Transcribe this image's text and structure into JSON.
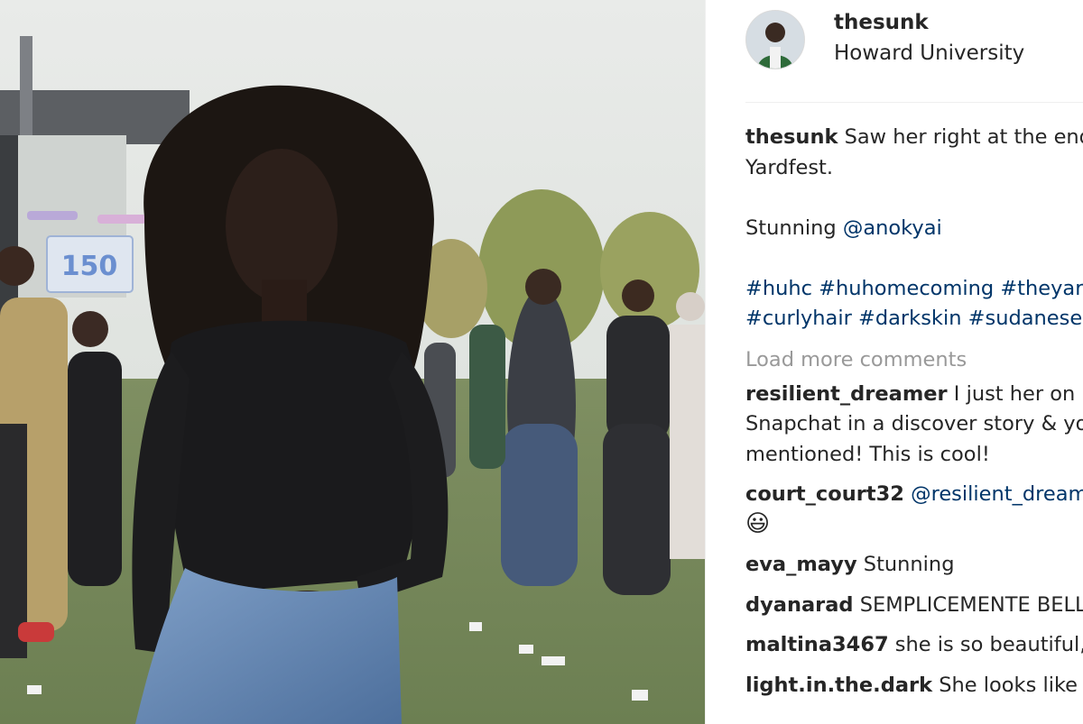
{
  "post": {
    "owner": "thesunk",
    "location": "Howard University",
    "caption": {
      "line1": "Saw her right at the end of",
      "line2": "Yardfest.",
      "line3_text": "Stunning ",
      "mention": "@anokyai",
      "hashtags_line1": "#huhc #huhomecoming #theyard",
      "hashtags_line2": "#curlyhair #darkskin #sudanese"
    },
    "load_more": "Load more comments"
  },
  "comments": [
    {
      "user": "resilient_dreamer",
      "lines": [
        "I just her on my",
        "Snapchat in a discover story & you were",
        "mentioned! This is cool!"
      ]
    },
    {
      "user": "court_court32",
      "mention": "@resilient_dreamer",
      "emoji": "😃"
    },
    {
      "user": "eva_mayy",
      "text": "Stunning"
    },
    {
      "user": "dyanarad",
      "text": "SEMPLICEMENTE BELLA"
    },
    {
      "user": "maltina3467",
      "text": "she is so beautiful,God"
    },
    {
      "user": "light.in.the.dark",
      "text": "She looks like a"
    }
  ],
  "photo": {
    "scoreboard": "150",
    "alt_subject": "woman with curly hair at outdoor festival"
  },
  "colors": {
    "link": "#003569",
    "muted": "#999999",
    "text": "#262626"
  }
}
